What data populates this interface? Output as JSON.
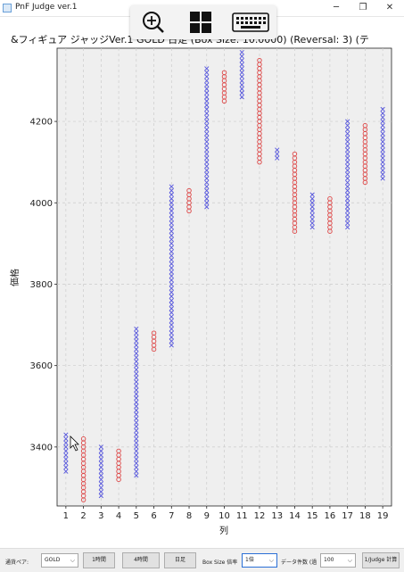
{
  "window": {
    "title": "PnF Judge ver.1",
    "minimize": "─",
    "maximize": "❐",
    "close": "✕"
  },
  "overlay_icons": [
    "zoom-in-icon",
    "windows-logo-icon",
    "keyboard-icon"
  ],
  "chart_title": "&フィギュア ジャッジVer.1 GOLD 日足 (Box Size: 10.0000) (Reversal: 3) (テ",
  "chart_data": {
    "type": "point-and-figure",
    "box_size": 10,
    "reversal": 3,
    "xlabel": "列",
    "ylabel": "価格",
    "xlim": [
      0.5,
      19.5
    ],
    "ylim": [
      3255,
      4380
    ],
    "grid": true,
    "x_ticks": [
      1,
      2,
      3,
      4,
      5,
      6,
      7,
      8,
      9,
      10,
      11,
      12,
      13,
      14,
      15,
      16,
      17,
      18,
      19
    ],
    "y_ticks": [
      3400,
      3600,
      3800,
      4000,
      4200
    ],
    "colors": {
      "X": "#5555dd",
      "O": "#dd4444",
      "plot_bg": "#efefef",
      "grid": "#cccccc"
    },
    "columns": [
      {
        "col": 1,
        "type": "X",
        "low": 3340,
        "high": 3430
      },
      {
        "col": 2,
        "type": "O",
        "low": 3270,
        "high": 3420
      },
      {
        "col": 3,
        "type": "X",
        "low": 3280,
        "high": 3400
      },
      {
        "col": 4,
        "type": "O",
        "low": 3320,
        "high": 3390
      },
      {
        "col": 5,
        "type": "X",
        "low": 3330,
        "high": 3690
      },
      {
        "col": 6,
        "type": "O",
        "low": 3640,
        "high": 3680
      },
      {
        "col": 7,
        "type": "X",
        "low": 3650,
        "high": 4040
      },
      {
        "col": 8,
        "type": "O",
        "low": 3980,
        "high": 4030
      },
      {
        "col": 9,
        "type": "X",
        "low": 3990,
        "high": 4330
      },
      {
        "col": 10,
        "type": "O",
        "low": 4250,
        "high": 4320
      },
      {
        "col": 11,
        "type": "X",
        "low": 4260,
        "high": 4370
      },
      {
        "col": 12,
        "type": "O",
        "low": 4100,
        "high": 4350
      },
      {
        "col": 13,
        "type": "X",
        "low": 4110,
        "high": 4130
      },
      {
        "col": 14,
        "type": "O",
        "low": 3930,
        "high": 4120
      },
      {
        "col": 15,
        "type": "X",
        "low": 3940,
        "high": 4020
      },
      {
        "col": 16,
        "type": "O",
        "low": 3930,
        "high": 4010
      },
      {
        "col": 17,
        "type": "X",
        "low": 3940,
        "high": 4200
      },
      {
        "col": 18,
        "type": "O",
        "low": 4050,
        "high": 4190
      },
      {
        "col": 19,
        "type": "X",
        "low": 4060,
        "high": 4230
      }
    ]
  },
  "controls": {
    "pair_label": "通貨ペア:",
    "pair_value": "GOLD",
    "btn_1h": "1時間",
    "btn_4h": "4時間",
    "btn_daily": "日足",
    "box_size_label": "Box Size 倍率",
    "box_size_value": "1倍",
    "data_count_label": "データ件数 (過",
    "data_count_value": "100",
    "judge_button": "1/Judge 計算"
  }
}
